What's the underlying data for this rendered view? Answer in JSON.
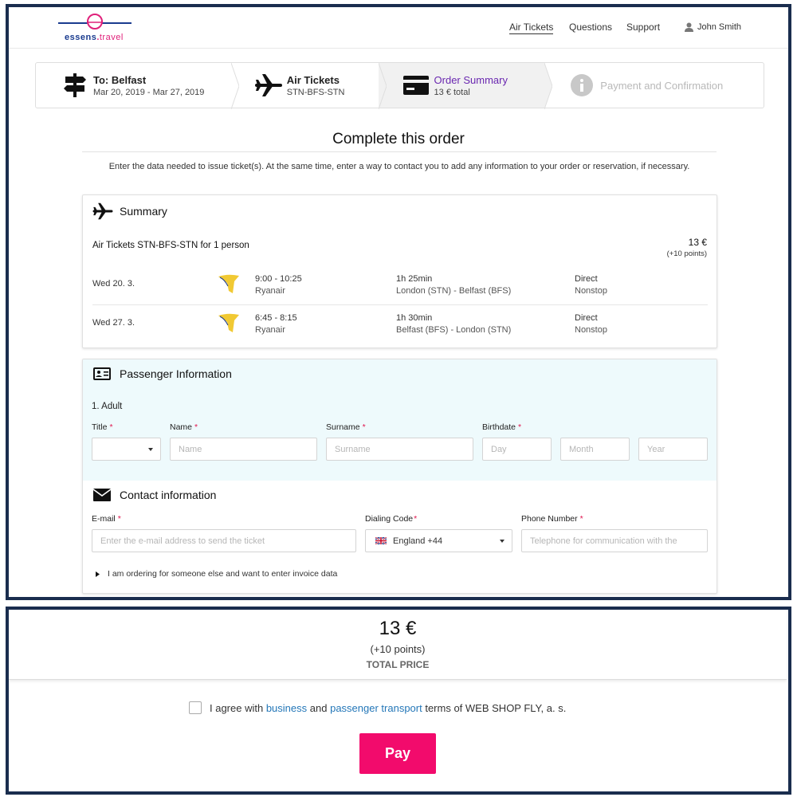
{
  "header": {
    "logo_text_a": "essens",
    "logo_text_dot": ".",
    "logo_text_b": "travel",
    "nav": [
      "Air Tickets",
      "Questions",
      "Support"
    ],
    "user_name": "John Smith"
  },
  "steps": [
    {
      "title": "To: Belfast",
      "subtitle": "Mar 20, 2019 - Mar 27, 2019",
      "icon": "signpost-icon",
      "state": "done"
    },
    {
      "title": "Air Tickets",
      "subtitle": "STN-BFS-STN",
      "icon": "airplane-icon",
      "state": "done"
    },
    {
      "title": "Order Summary",
      "subtitle": "13 € total",
      "icon": "credit-card-icon",
      "state": "current"
    },
    {
      "title": "Payment and Confirmation",
      "subtitle": "",
      "icon": "info-icon",
      "state": "disabled"
    }
  ],
  "main": {
    "title": "Complete this order",
    "intro": "Enter the data needed to issue ticket(s). At the same time, enter a way to contact you to add any information to your order or reservation, if necessary."
  },
  "summary": {
    "title": "Summary",
    "row_title": "Air Tickets STN-BFS-STN for 1 person",
    "price": "13 €",
    "points": "(+10 points)",
    "flights": [
      {
        "date": "Wed 20. 3.",
        "time": "9:00 - 10:25",
        "airline": "Ryanair",
        "duration": "1h 25min",
        "route": "London (STN) - Belfast (BFS)",
        "type": "Direct",
        "stops": "Nonstop"
      },
      {
        "date": "Wed 27. 3.",
        "time": "6:45 - 8:15",
        "airline": "Ryanair",
        "duration": "1h 30min",
        "route": "Belfast (BFS) - London (STN)",
        "type": "Direct",
        "stops": "Nonstop"
      }
    ]
  },
  "passenger": {
    "title": "Passenger Information",
    "adult_label": "1. Adult",
    "labels": {
      "title": "Title",
      "name": "Name",
      "surname": "Surname",
      "birthdate": "Birthdate"
    },
    "required_mark": "*",
    "placeholders": {
      "name": "Name",
      "surname": "Surname",
      "day": "Day",
      "month": "Month",
      "year": "Year"
    }
  },
  "contact": {
    "title": "Contact information",
    "labels": {
      "email": "E-mail",
      "dialing": "Dialing Code",
      "phone": "Phone Number"
    },
    "placeholders": {
      "email": "Enter the e-mail address to send the ticket",
      "phone": "Telephone for communication with the"
    },
    "dialing_value": "England +44",
    "invoice_toggle": "I am ordering for someone else and want to enter invoice data"
  },
  "totals": {
    "amount": "13 €",
    "points": "(+10 points)",
    "label": "TOTAL PRICE"
  },
  "agree": {
    "prefix": "I agree with",
    "link1": "business",
    "mid": "and",
    "link2": "passenger transport",
    "suffix": "terms of WEB SHOP FLY, a. s."
  },
  "pay_label": "Pay",
  "colors": {
    "accent_purple": "#6a27b0",
    "pay_pink": "#f20b6c",
    "link_blue": "#2477b8",
    "frame_navy": "#1a2d4e",
    "ryanair_yellow": "#f1c933"
  }
}
